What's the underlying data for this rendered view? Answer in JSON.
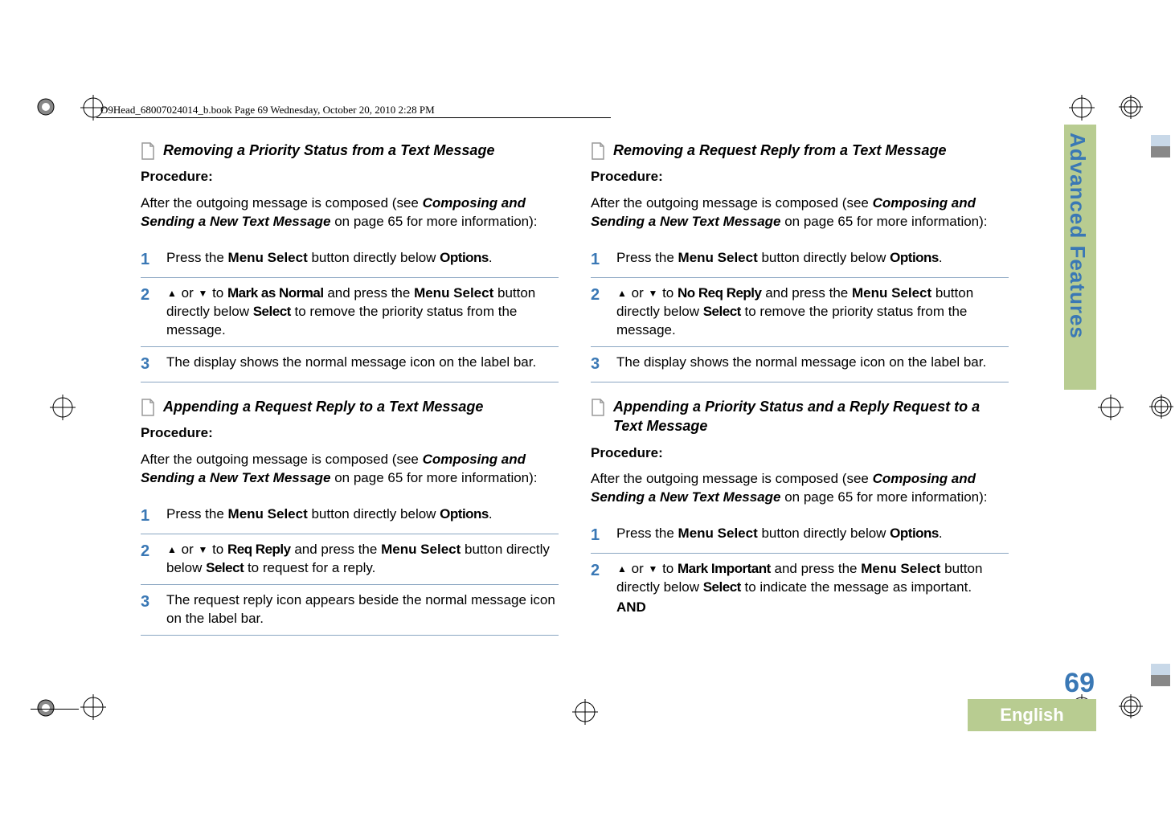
{
  "header_line": "O9Head_68007024014_b.book  Page 69  Wednesday, October 20, 2010  2:28 PM",
  "side_tab": "Advanced Features",
  "page_number": "69",
  "language": "English",
  "shared": {
    "procedure_label": "Procedure:",
    "intro_prefix": "After the outgoing message is composed (see ",
    "intro_bold": "Composing and Sending a New Text Message",
    "intro_suffix": " on page 65 for more information):",
    "menu_select": "Menu Select",
    "options": "Options",
    "select": "Select",
    "and": "AND",
    "up": "▲",
    "down": "▼",
    "press_the": "Press the ",
    "button_below": " button directly below ",
    "or": " or ",
    "to": " to ",
    "and_press": " and press the "
  },
  "sections": {
    "s1": {
      "title": "Removing a Priority Status from a Text Message",
      "step2_target": "Mark as Normal",
      "step2_tail": " to remove the priority status from the message.",
      "step3": "The display shows the normal message icon on the label bar."
    },
    "s2": {
      "title": "Appending a Request Reply to a Text Message",
      "step2_target": "Req Reply",
      "step2_tail": " to request for a reply.",
      "step2_btn": " button directly below ",
      "step3": "The request reply icon appears beside the normal message icon on the label bar."
    },
    "s3": {
      "title": "Removing a Request Reply from a Text Message",
      "step2_target": "No Req Reply",
      "step2_tail": " to remove the priority status from the message.",
      "step2_btn": " button directly below ",
      "step3": "The display shows the normal message icon on the label bar."
    },
    "s4": {
      "title": "Appending a Priority Status and a Reply Request to a Text Message",
      "step2_target": "Mark Important",
      "step2_tail": " to indicate the message as important."
    }
  },
  "nums": {
    "n1": "1",
    "n2": "2",
    "n3": "3"
  }
}
